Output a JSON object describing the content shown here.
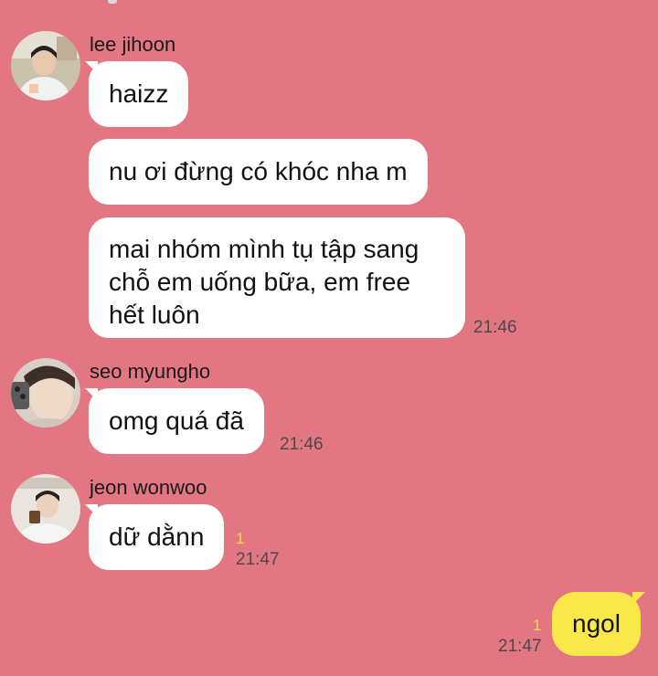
{
  "messages": {
    "group1": {
      "sender": "lee jihoon",
      "bubbles": [
        "haizz",
        "nu ơi đừng có khóc nha m",
        "mai nhóm mình tụ tập sang chỗ em uống bữa, em free hết luôn"
      ],
      "time": "21:46"
    },
    "group2": {
      "sender": "seo myungho",
      "bubbles": [
        "omg quá đã"
      ],
      "time": "21:46"
    },
    "group3": {
      "sender": "jeon wonwoo",
      "bubbles": [
        "dữ dằnn"
      ],
      "unread": "1",
      "time": "21:47"
    },
    "mine": {
      "bubble": "ngol",
      "unread": "1",
      "time": "21:47"
    }
  },
  "colors": {
    "background": "#e37683",
    "incoming_bubble": "#ffffff",
    "outgoing_bubble": "#fae84a",
    "unread_count": "#f4e23a"
  },
  "icons": {
    "avatar_1": "profile-photo",
    "avatar_2": "profile-photo",
    "avatar_3": "profile-photo"
  }
}
